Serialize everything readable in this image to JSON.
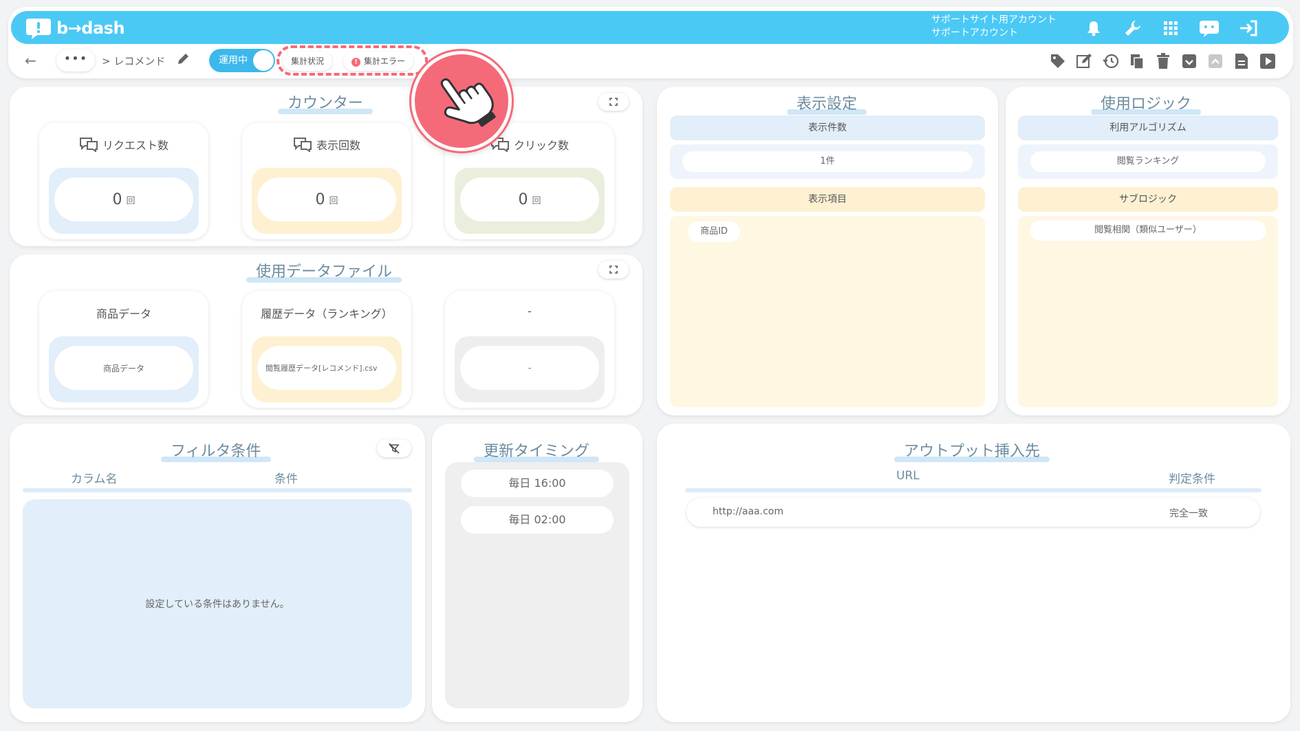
{
  "app": {
    "logo_text": "b→dash",
    "account_line1": "サポートサイト用アカウント",
    "account_line2": "サポートアカウント"
  },
  "nav": {
    "more_label": "•••",
    "breadcrumb": "> レコメンド",
    "status_toggle": "運用中",
    "chip_status": "集計状況",
    "chip_error_mark": "!",
    "chip_error": "集計エラー"
  },
  "counter": {
    "title": "カウンター",
    "cards": [
      {
        "label": "リクエスト数",
        "value": "0",
        "unit": "回"
      },
      {
        "label": "表示回数",
        "value": "0",
        "unit": "回"
      },
      {
        "label": "クリック数",
        "value": "0",
        "unit": "回"
      }
    ]
  },
  "datafiles": {
    "title": "使用データファイル",
    "cards": [
      {
        "label": "商品データ",
        "value": "商品データ"
      },
      {
        "label": "履歴データ（ランキング）",
        "value": "閲覧履歴データ[レコメンド].csv"
      },
      {
        "label": "-",
        "value": "-"
      }
    ]
  },
  "display": {
    "title": "表示設定",
    "count_label": "表示件数",
    "count_value": "1件",
    "items_label": "表示項目",
    "items": [
      "商品ID"
    ]
  },
  "logic": {
    "title": "使用ロジック",
    "algo_label": "利用アルゴリズム",
    "algo_value": "閲覧ランキング",
    "sub_label": "サブロジック",
    "sub_value": "閲覧相関（類似ユーザー）"
  },
  "filter": {
    "title": "フィルタ条件",
    "col_name": "カラム名",
    "col_cond": "条件",
    "empty_text": "設定している条件はありません。"
  },
  "timing": {
    "title": "更新タイミング",
    "times": [
      "毎日 16:00",
      "毎日 02:00"
    ]
  },
  "output": {
    "title": "アウトプット挿入先",
    "col_url": "URL",
    "col_cond": "判定条件",
    "rows": [
      {
        "url": "http://aaa.com",
        "cond": "完全一致"
      }
    ]
  },
  "colors": {
    "brand": "#4bc9f5",
    "accent": "#f56a79",
    "title_text": "#6d8ca0"
  }
}
